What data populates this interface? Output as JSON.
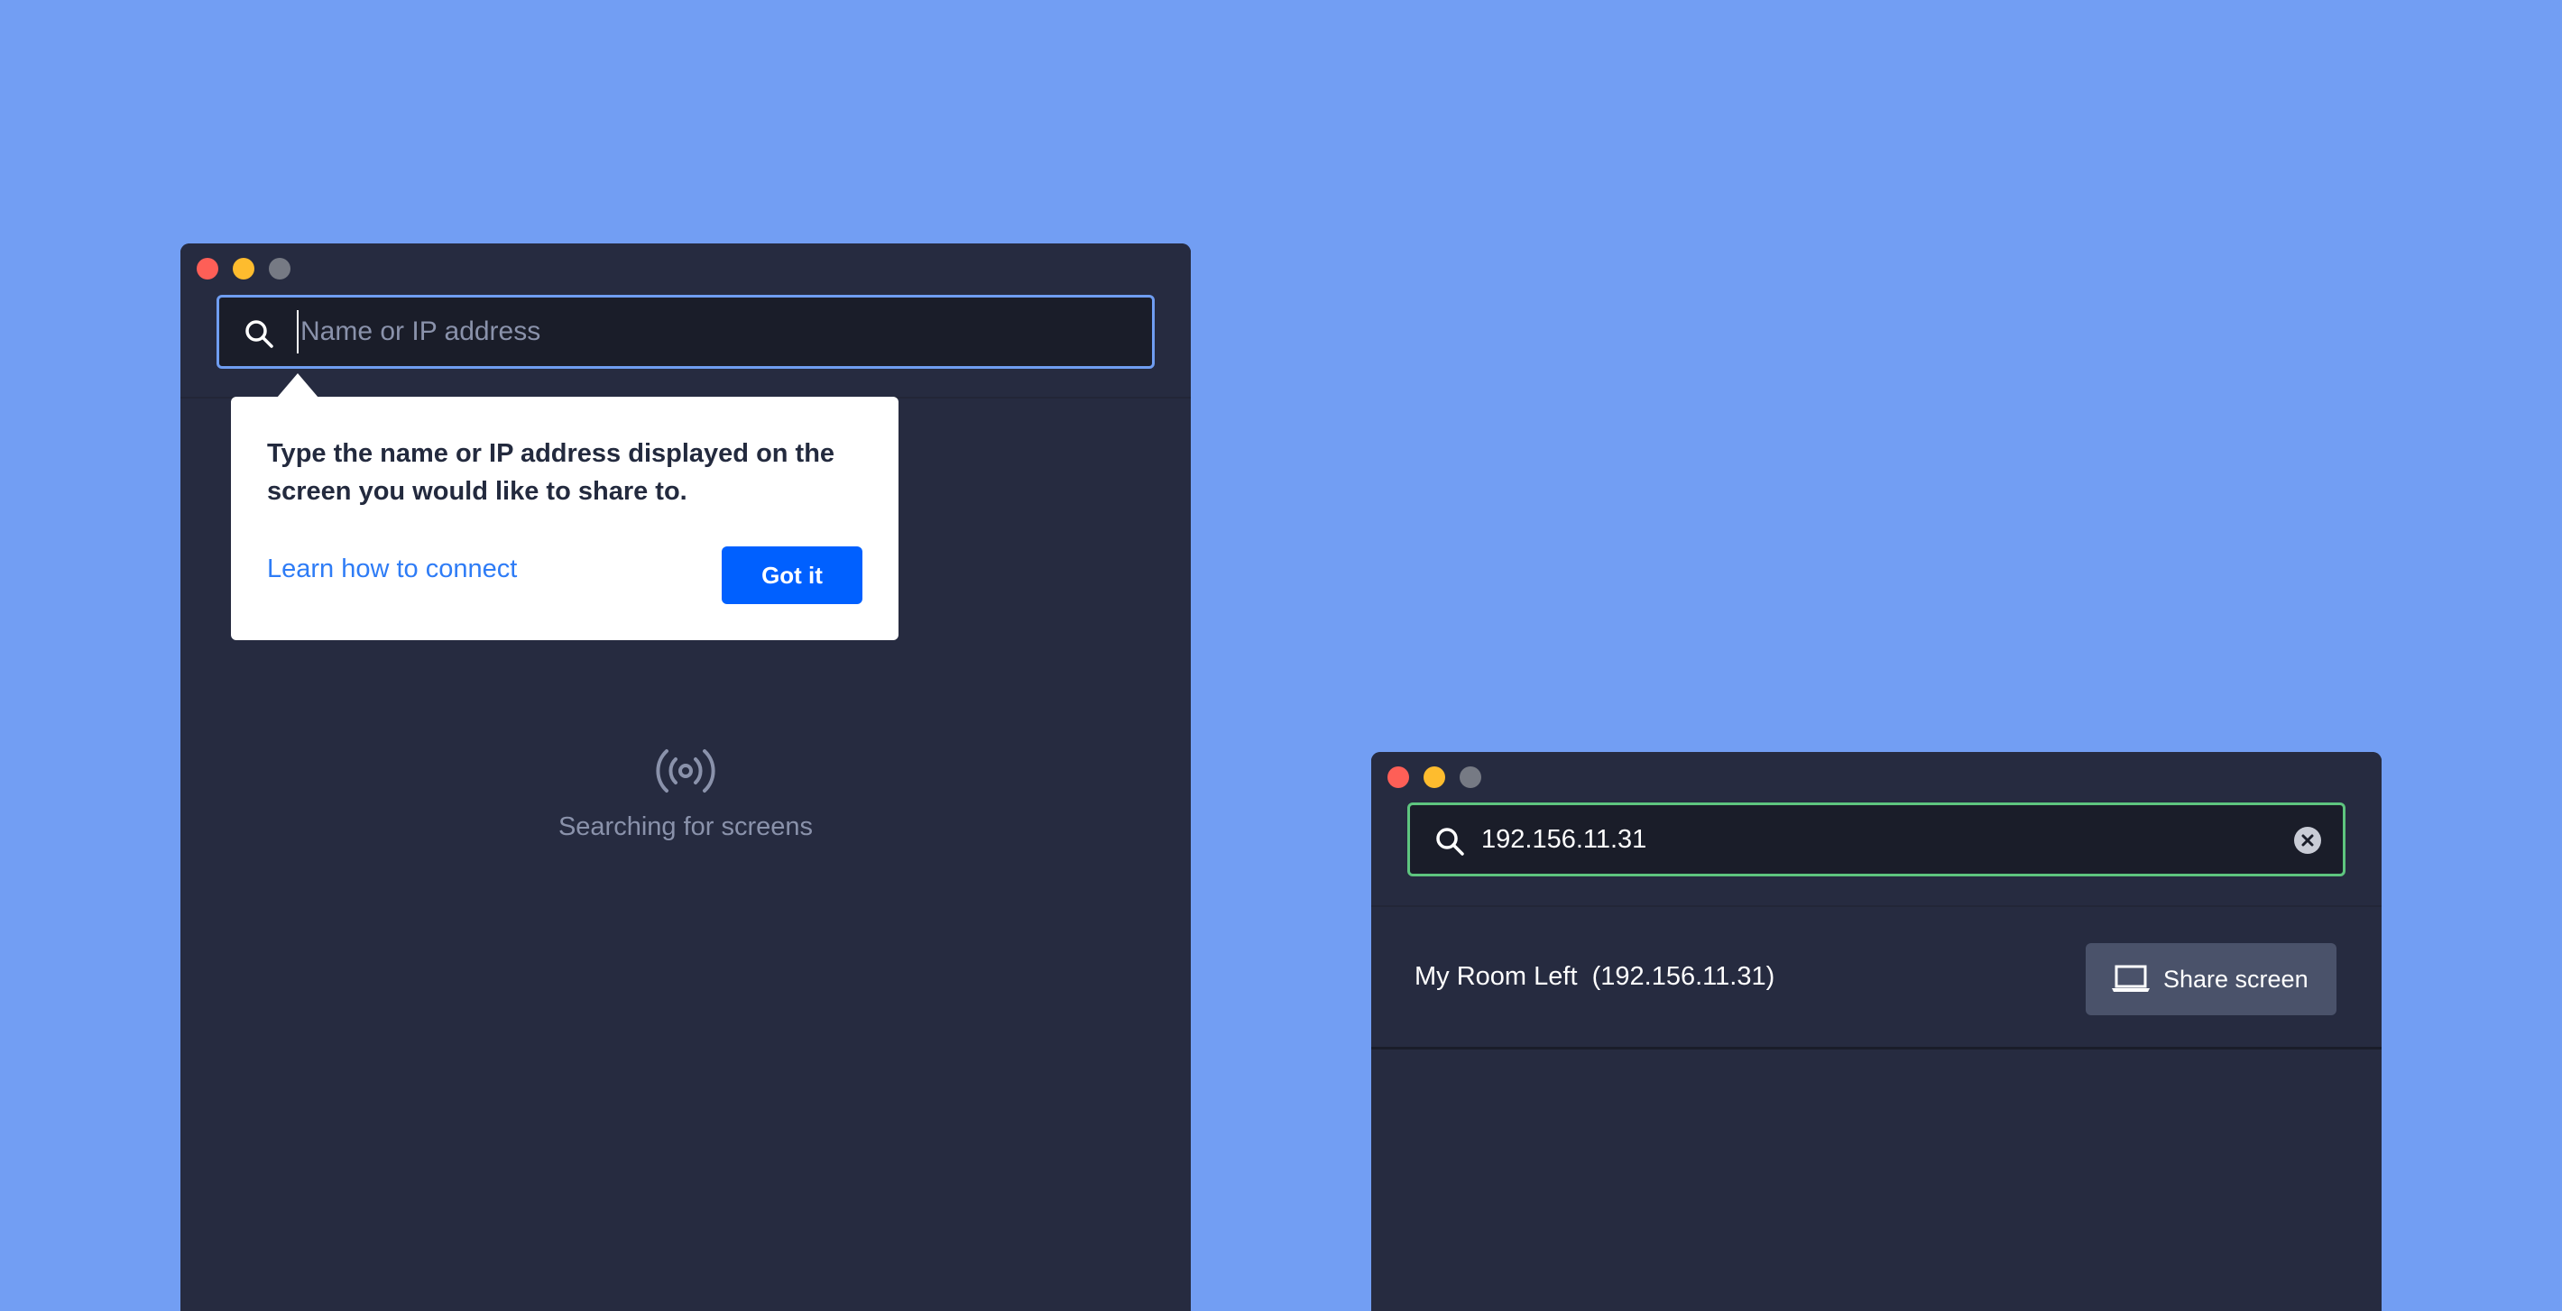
{
  "colors": {
    "background": "#729ef3",
    "window": "#262b40",
    "search_focus_border": "#6f9df1",
    "search_valid_border": "#5ec57f",
    "primary_button": "#0060ff",
    "link": "#2e7cf6"
  },
  "left_window": {
    "search": {
      "placeholder": "Name or IP address",
      "value": "",
      "icon": "search-icon"
    },
    "tooltip": {
      "message": "Type the name or IP address displayed on the screen you would like to share to.",
      "link_label": "Learn how to connect",
      "button_label": "Got it"
    },
    "status": {
      "icon": "broadcast-icon",
      "label": "Searching for screens"
    }
  },
  "right_window": {
    "search": {
      "value": "192.156.11.31",
      "icon": "search-icon",
      "clear_icon": "clear-icon"
    },
    "results": [
      {
        "name": "My Room Left",
        "ip": "(192.156.11.31)",
        "action_label": "Share screen",
        "action_icon": "laptop-icon"
      }
    ]
  }
}
